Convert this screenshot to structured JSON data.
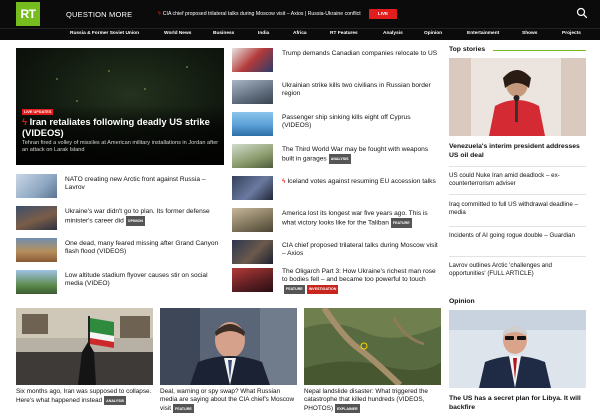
{
  "header": {
    "logo_text": "RT",
    "question_more": "QUESTION MORE",
    "ticker": "CIA chief proposed trilateral talks during Moscow visit – Axios | Russia-Ukraine conflict",
    "live_label": "LIVE"
  },
  "nav": [
    "Russia & Former Soviet Union",
    "World News",
    "Business",
    "India",
    "Africa",
    "RT Features",
    "Analysis",
    "Opinion",
    "Entertainment",
    "Shows",
    "Projects"
  ],
  "hero": {
    "badge": "LIVE UPDATES",
    "title": "Iran retaliates following deadly US strike (VIDEOS)",
    "subtitle": "Tehran fired a volley of missiles at American military installations in Jordan after an attack on Larak Island"
  },
  "left_stories": [
    {
      "title": "NATO creating new Arctic front against Russia – Lavrov"
    },
    {
      "title": "Ukraine's war didn't go to plan. Its former defense minister's career did",
      "tag": "OPINION"
    },
    {
      "title": "One dead, many feared missing after Grand Canyon flash flood (VIDEOS)"
    },
    {
      "title": "Low altitude stadium flyover causes stir on social media (VIDEO)"
    }
  ],
  "mid_stories": [
    {
      "title": "Trump demands Canadian companies relocate to US"
    },
    {
      "title": "Ukrainian strike kills two civilians in Russian border region"
    },
    {
      "title": "Passenger ship sinking kills eight off Cyprus (VIDEOS)"
    },
    {
      "title": "The Third World War may be fought with weapons built in garages",
      "tag": "ANALYSIS"
    },
    {
      "title": "Iceland votes against resuming EU accession talks",
      "bolt": true
    },
    {
      "title": "America lost its longest war five years ago. This is what victory looks like for the Taliban",
      "tag": "FEATURE"
    },
    {
      "title": "CIA chief proposed trilateral talks during Moscow visit – Axios"
    },
    {
      "title": "The Oligarch Part 3: How Ukraine's richest man rose to bodies fell – and became too powerful to touch",
      "tag": "FEATURE",
      "tag2": "INVESTIGATION"
    }
  ],
  "top_stories": {
    "heading": "Top stories",
    "lead": "Venezuela's interim president addresses US oil deal",
    "items": [
      "US could Nuke Iran amid deadlock – ex-counterterrorism adviser",
      "Iraq committed to full US withdrawal deadline – media",
      "Incidents of AI going rogue double – Guardian",
      "Lavrov outlines Arctic 'challenges and opportunities' (FULL ARTICLE)"
    ]
  },
  "opinion": {
    "heading": "Opinion",
    "title": "The US has a secret plan for Libya. It will backfire"
  },
  "bottom": [
    {
      "title": "Six months ago, Iran was supposed to collapse. Here's what happened instead",
      "tag": "ANALYSIS"
    },
    {
      "title": "Deal, warning or spy swap? What Russian media are saying about the CIA chief's Moscow visit",
      "tag": "FEATURE"
    },
    {
      "title": "Nepal landslide disaster: What triggered the catastrophe that killed hundreds (VIDEOS, PHOTOS)",
      "tag": "EXPLAINER"
    }
  ],
  "colors": {
    "brand": "#77bc1f",
    "live": "#e21d1d",
    "header": "#0b0b0b"
  }
}
